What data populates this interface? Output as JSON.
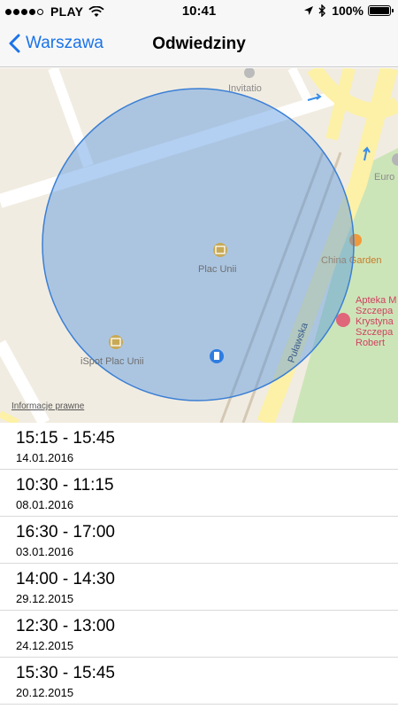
{
  "status_bar": {
    "carrier": "PLAY",
    "time": "10:41",
    "battery": "100%"
  },
  "nav": {
    "back_label": "Warszawa",
    "title": "Odwiedziny"
  },
  "map": {
    "places": {
      "invitatio": "Invitatio",
      "euro": "Euro",
      "plac_unii": "Plac Unii",
      "china_garden": "China Garden",
      "apteka_line1": "Apteka M",
      "apteka_line2": "Szczepa",
      "apteka_line3": "Krystyna",
      "apteka_line4": "Szczepa",
      "apteka_line5": "Robert",
      "ispot": "iSpot Plac Unii",
      "street": "Puławska"
    },
    "legal": "Informacje prawne",
    "colors": {
      "circle": "#4a90e2",
      "park": "#cce5b8",
      "road": "#fdf1a7"
    }
  },
  "visits": [
    {
      "time": "15:15 - 15:45",
      "date": "14.01.2016"
    },
    {
      "time": "10:30 - 11:15",
      "date": "08.01.2016"
    },
    {
      "time": "16:30 - 17:00",
      "date": "03.01.2016"
    },
    {
      "time": "14:00 - 14:30",
      "date": "29.12.2015"
    },
    {
      "time": "12:30 - 13:00",
      "date": "24.12.2015"
    },
    {
      "time": "15:30 - 15:45",
      "date": "20.12.2015"
    }
  ]
}
